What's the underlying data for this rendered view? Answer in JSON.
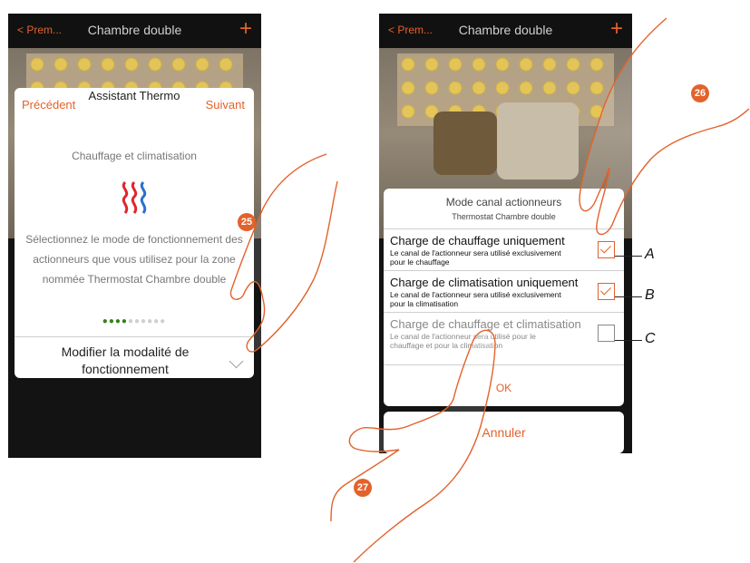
{
  "left_screen": {
    "header": {
      "back": "< Prem...",
      "title": "Chambre double",
      "plus": "+"
    },
    "wizard": {
      "prev": "Précédent",
      "title": "Assistant Thermo",
      "next": "Suivant",
      "subtitle": "Chauffage et climatisation",
      "description": "Sélectionnez le mode de fonctionnement des actionneurs que vous utilisez pour la zone nommée Thermostat Chambre double",
      "action": "Modifier la modalité de fonctionnement"
    },
    "dots": {
      "active": 4,
      "total": 10
    }
  },
  "right_screen": {
    "header": {
      "back": "< Prem...",
      "title": "Chambre double",
      "plus": "+"
    },
    "dialog": {
      "title": "Mode canal actionneurs",
      "subtitle": "Thermostat Chambre double",
      "options": [
        {
          "title": "Charge de chauffage uniquement",
          "desc": "Le canal de l'actionneur sera utilisé exclusivement pour le chauffage",
          "checked": true,
          "marker": "A"
        },
        {
          "title": "Charge de climatisation uniquement",
          "desc": "Le canal de l'actionneur sera utilisé exclusivement pour la climatisation",
          "checked": true,
          "marker": "B"
        },
        {
          "title": "Charge de chauffage et climatisation",
          "desc": "Le canal de l'actionneur sera utilisé pour le chauffage et pour la climatisation",
          "checked": false,
          "marker": "C"
        }
      ],
      "ok": "OK"
    },
    "cancel": "Annuler"
  },
  "steps": [
    "25",
    "26",
    "27"
  ],
  "colors": {
    "accent": "#e3622b",
    "dark": "#131313"
  }
}
